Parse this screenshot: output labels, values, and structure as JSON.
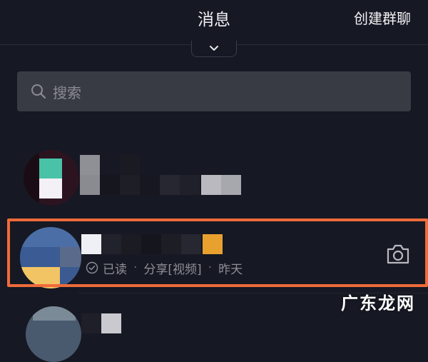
{
  "header": {
    "title": "消息",
    "action_label": "创建群聊",
    "collapse_icon": "chevron-down-icon"
  },
  "search": {
    "placeholder": "搜索",
    "icon": "search-icon"
  },
  "conversations": [
    {
      "name": "",
      "preview": "",
      "blurred": true
    },
    {
      "name": "",
      "status_icon": "check-circle-icon",
      "status": "已读",
      "message": "分享[视频]",
      "time": "昨天",
      "action_icon": "camera-icon",
      "highlighted": true,
      "highlight_color": "#ee6b3a",
      "blurred": true
    },
    {
      "name": "",
      "blurred": true
    }
  ],
  "watermark": "广东龙网",
  "colors": {
    "background": "#161823",
    "search_bg": "#393b44",
    "highlight": "#ee6b3a",
    "text_primary": "#f2f2f4",
    "text_secondary": "#8e8f97"
  }
}
